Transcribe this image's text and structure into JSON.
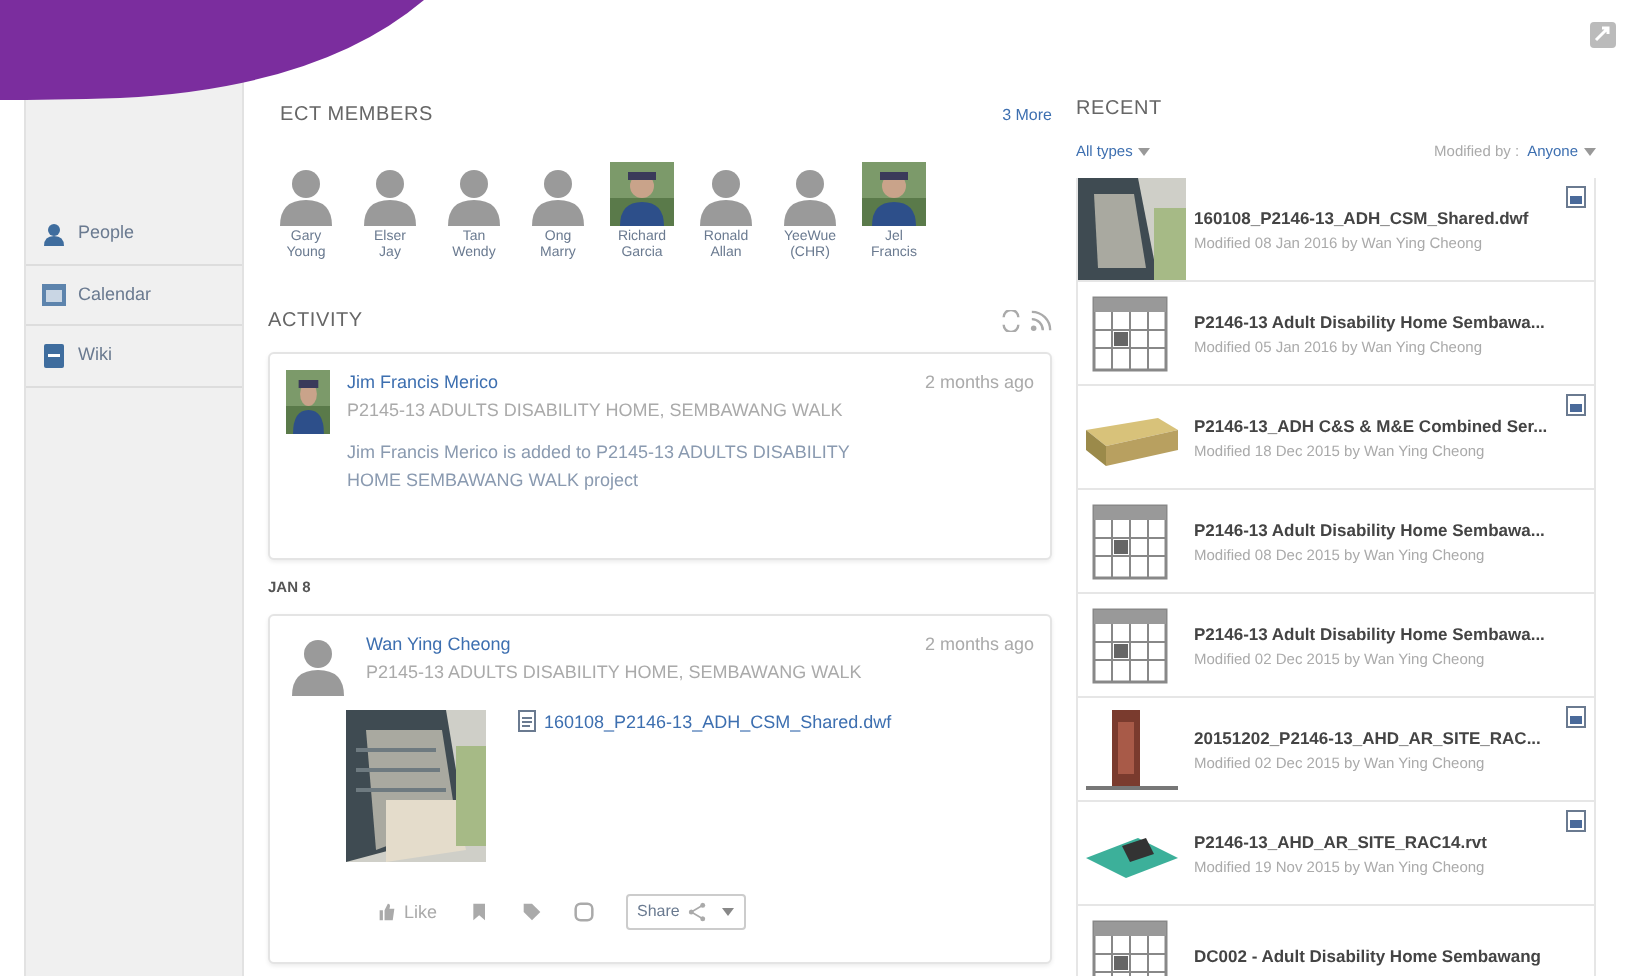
{
  "sidebar": {
    "items": [
      {
        "label": "People"
      },
      {
        "label": "Calendar"
      },
      {
        "label": "Wiki"
      }
    ]
  },
  "members": {
    "title": "ECT MEMBERS",
    "more": "3 More",
    "people": [
      {
        "first": "Gary",
        "last": "Young",
        "kind": "silhouette"
      },
      {
        "first": "Elser",
        "last": "Jay",
        "kind": "silhouette"
      },
      {
        "first": "Tan",
        "last": "Wendy",
        "kind": "silhouette"
      },
      {
        "first": "Ong",
        "last": "Marry",
        "kind": "silhouette"
      },
      {
        "first": "Richard",
        "last": "Garcia",
        "kind": "picture"
      },
      {
        "first": "Ronald",
        "last": "Allan",
        "kind": "silhouette"
      },
      {
        "first": "YeeWue",
        "last": "(CHR)",
        "kind": "silhouette"
      },
      {
        "first": "Jel",
        "last": "Francis",
        "kind": "picture"
      }
    ]
  },
  "activity": {
    "title": "ACTIVITY",
    "entries": [
      {
        "author": "Jim Francis Merico",
        "project": "P2145-13 ADULTS DISABILITY HOME, SEMBAWANG WALK",
        "time": "2 months ago",
        "kind": "picture",
        "text": "Jim Francis Merico is added to P2145-13 ADULTS DISABILITY HOME SEMBAWANG WALK project"
      },
      {
        "date": "JAN 8",
        "author": "Wan Ying Cheong",
        "project": "P2145-13 ADULTS DISABILITY HOME, SEMBAWANG WALK",
        "time": "2 months ago",
        "kind": "silhouette",
        "file": "160108_P2146-13_ADH_CSM_Shared.dwf",
        "like": "Like",
        "share": "Share"
      }
    ]
  },
  "recent": {
    "title": "RECENT",
    "type_filter": "All types",
    "modified_label": "Modified by :",
    "modified_value": "Anyone",
    "items": [
      {
        "name": "160108_P2146-13_ADH_CSM_Shared.dwf",
        "meta": "Modified 08 Jan 2016 by Wan Ying Cheong",
        "kind": "building",
        "badge": true
      },
      {
        "name": "P2146-13 Adult Disability Home Sembawa...",
        "meta": "Modified 05 Jan 2016 by Wan Ying Cheong",
        "kind": "calendar",
        "badge": false
      },
      {
        "name": "P2146-13_ADH C&S & M&E Combined Ser...",
        "meta": "Modified 18 Dec 2015 by Wan Ying Cheong",
        "kind": "block",
        "badge": true
      },
      {
        "name": "P2146-13 Adult Disability Home Sembawa...",
        "meta": "Modified 08 Dec 2015 by Wan Ying Cheong",
        "kind": "calendar",
        "badge": false
      },
      {
        "name": "P2146-13 Adult Disability Home Sembawa...",
        "meta": "Modified 02 Dec 2015 by Wan Ying Cheong",
        "kind": "calendar",
        "badge": false
      },
      {
        "name": "20151202_P2146-13_AHD_AR_SITE_RAC...",
        "meta": "Modified 02 Dec 2015 by Wan Ying Cheong",
        "kind": "tower",
        "badge": true
      },
      {
        "name": "P2146-13_AHD_AR_SITE_RAC14.rvt",
        "meta": "Modified 19 Nov 2015 by Wan Ying Cheong",
        "kind": "slab",
        "badge": true
      },
      {
        "name": "DC002 - Adult Disability Home Sembawang",
        "kind": "calendar",
        "badge": false
      }
    ]
  }
}
